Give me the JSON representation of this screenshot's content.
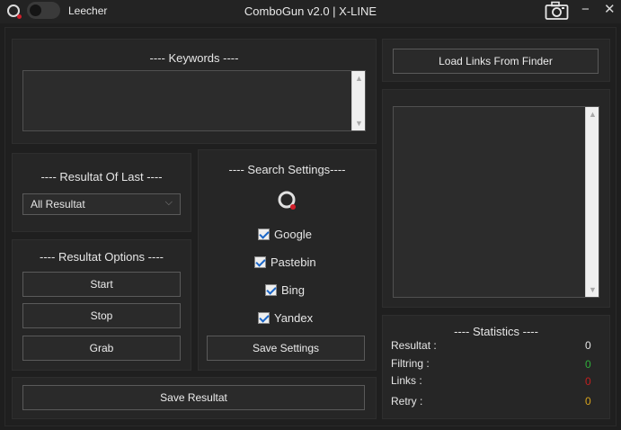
{
  "window": {
    "title": "ComboGun v2.0 | X-LINE",
    "mode_label": "Leecher",
    "minimize_label": "−",
    "close_label": "✕"
  },
  "keywords": {
    "title": "---- Keywords ----",
    "value": ""
  },
  "resultat_of_last": {
    "title": "---- Resultat Of Last ----",
    "selected": "All Resultat"
  },
  "resultat_options": {
    "title": "---- Resultat Options ----",
    "start_label": "Start",
    "stop_label": "Stop",
    "grab_label": "Grab"
  },
  "search_settings": {
    "title": "---- Search Settings----",
    "engines": [
      {
        "label": "Google",
        "checked": true
      },
      {
        "label": "Pastebin",
        "checked": true
      },
      {
        "label": "Bing",
        "checked": true
      },
      {
        "label": "Yandex",
        "checked": true
      }
    ],
    "save_label": "Save Settings"
  },
  "save_resultat_label": "Save Resultat",
  "finder": {
    "load_label": "Load Links From Finder",
    "value": ""
  },
  "statistics": {
    "title": "---- Statistics ----",
    "rows": [
      {
        "label": "Resultat :",
        "value": "0",
        "color": "#e6e6e6"
      },
      {
        "label": "Filtring :",
        "value": "0",
        "color": "#2fae3a"
      },
      {
        "label": "Links :",
        "value": "0",
        "color": "#c21f1f"
      },
      {
        "label": "Retry :",
        "value": "0",
        "color": "#d6a21c"
      }
    ]
  },
  "icons": {
    "app": "search-icon",
    "camera": "camera-icon",
    "spinner": "loading-spinner-icon"
  }
}
